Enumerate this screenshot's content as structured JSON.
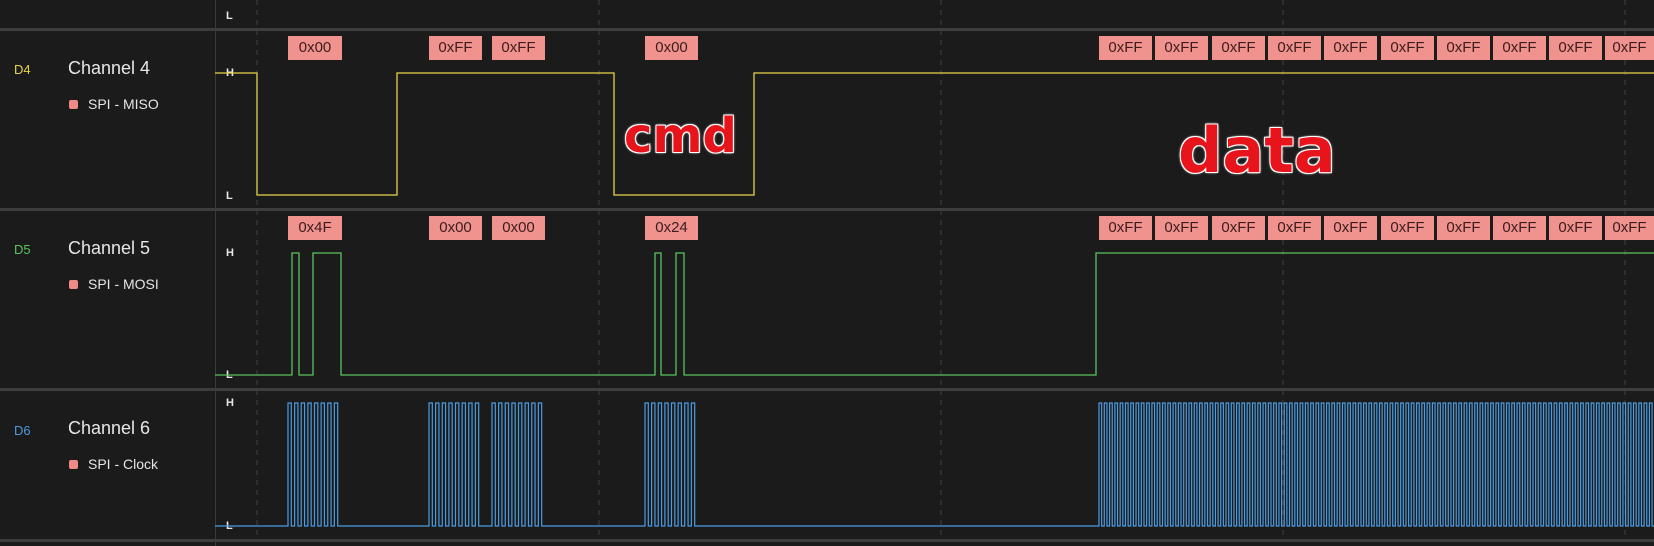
{
  "top": {
    "level_label": "L"
  },
  "channels": [
    {
      "tag": "D4",
      "name": "Channel 4",
      "color": "#e6d44a",
      "analyzer": "SPI - MISO",
      "high_label": "H",
      "low_label": "L",
      "packets": [
        "0x00",
        "0xFF",
        "0xFF",
        "0x00",
        "0xFF",
        "0xFF",
        "0xFF",
        "0xFF",
        "0xFF",
        "0xFF",
        "0xFF",
        "0xFF",
        "0xFF",
        "0xFF"
      ]
    },
    {
      "tag": "D5",
      "name": "Channel 5",
      "color": "#58c45e",
      "analyzer": "SPI - MOSI",
      "high_label": "H",
      "low_label": "L",
      "packets": [
        "0x4F",
        "0x00",
        "0x00",
        "0x24",
        "0xFF",
        "0xFF",
        "0xFF",
        "0xFF",
        "0xFF",
        "0xFF",
        "0xFF",
        "0xFF",
        "0xFF",
        "0xFF"
      ]
    },
    {
      "tag": "D6",
      "name": "Channel 6",
      "color": "#4a9be0",
      "analyzer": "SPI - Clock",
      "high_label": "H",
      "low_label": "L"
    }
  ],
  "annotations": {
    "cmd": "cmd",
    "data": "data"
  },
  "colors": {
    "packet_bg": "#f0928e",
    "background": "#1b1b1b"
  }
}
